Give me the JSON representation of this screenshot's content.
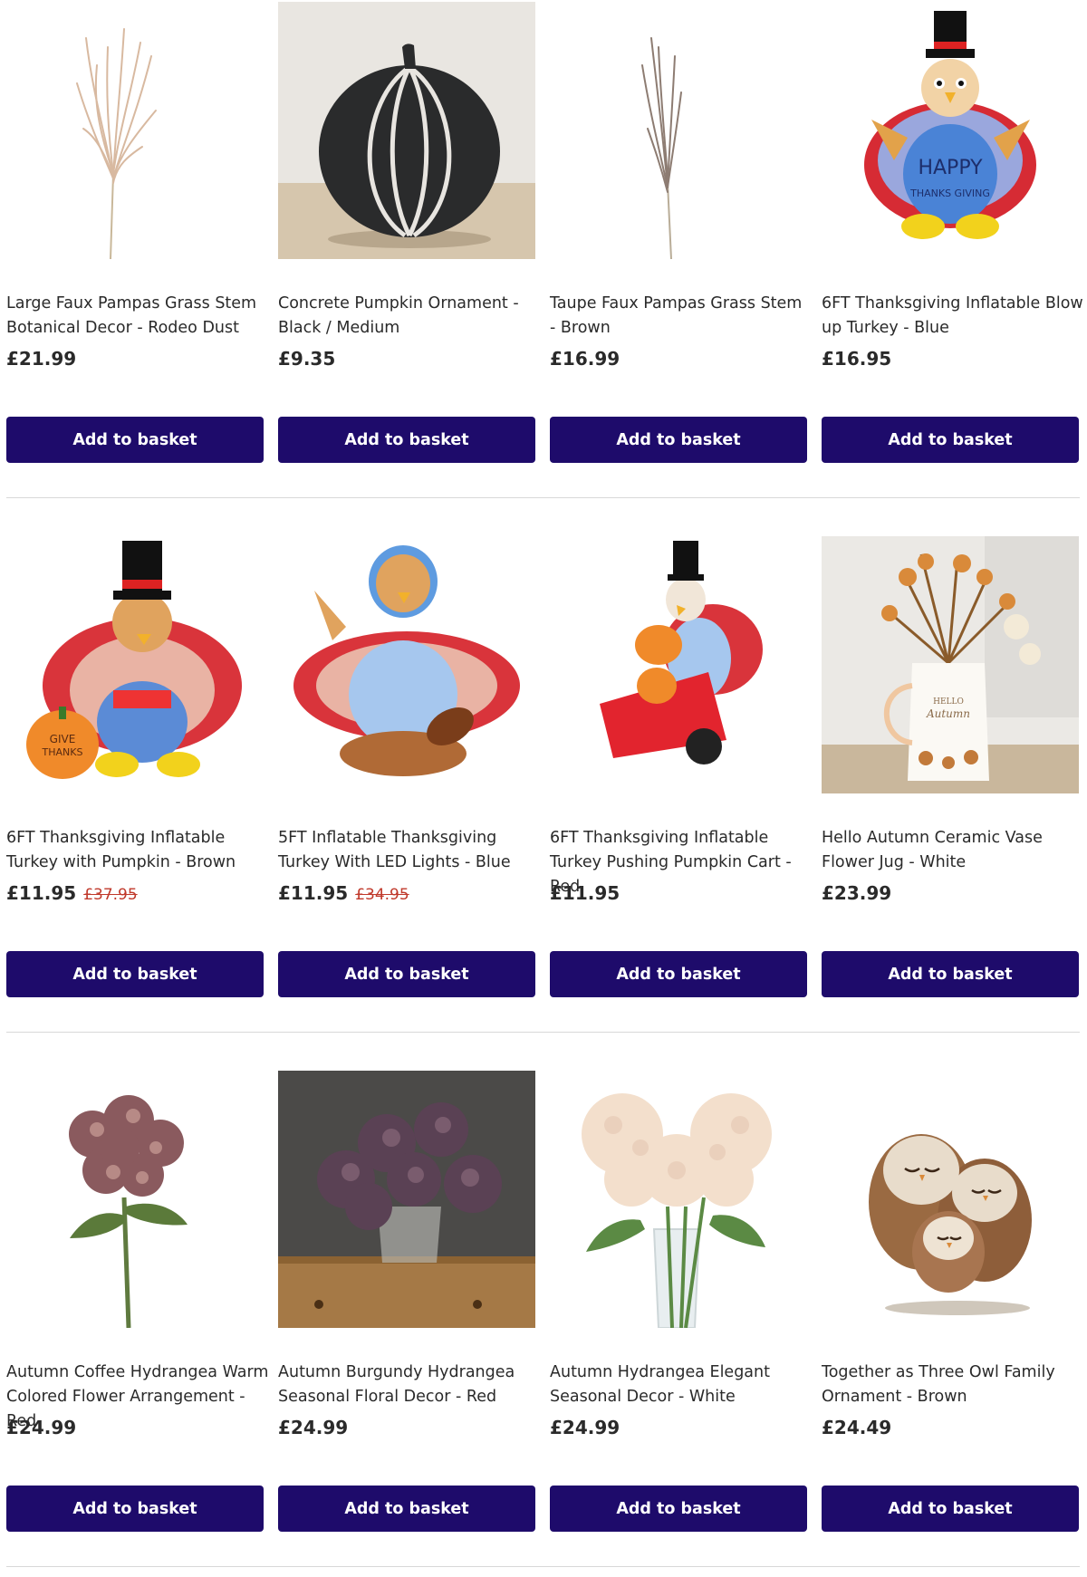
{
  "theme": {
    "button_bg": "#1e0b6b",
    "button_text": "#ffffff",
    "sale_price": "#c0392b",
    "divider": "#d8d8d8"
  },
  "products": [
    {
      "title": "Large Faux Pampas Grass Stem Botanical Decor - Rodeo Dust",
      "price": "£21.99",
      "old_price": "",
      "button": "Add to basket",
      "image": "pampas-grass-rodeo-dust"
    },
    {
      "title": "Concrete Pumpkin Ornament - Black / Medium",
      "price": "£9.35",
      "old_price": "",
      "button": "Add to basket",
      "image": "black-concrete-pumpkin"
    },
    {
      "title": "Taupe Faux Pampas Grass Stem - Brown",
      "price": "£16.99",
      "old_price": "",
      "button": "Add to basket",
      "image": "pampas-grass-taupe"
    },
    {
      "title": "6FT Thanksgiving Inflatable Blow up Turkey - Blue",
      "price": "£16.95",
      "old_price": "",
      "button": "Add to basket",
      "image": "inflatable-turkey-blue",
      "image_text_1": "HAPPY",
      "image_text_2": "THANKS GIVING"
    },
    {
      "title": "6FT Thanksgiving Inflatable Turkey with Pumpkin - Brown",
      "price": "£11.95",
      "old_price": "£37.95",
      "button": "Add to basket",
      "image": "inflatable-turkey-pumpkin",
      "image_text_1": "GIVE",
      "image_text_2": "THANKS"
    },
    {
      "title": "5FT Inflatable Thanksgiving Turkey With LED Lights - Blue",
      "price": "£11.95",
      "old_price": "£34.95",
      "button": "Add to basket",
      "image": "inflatable-turkey-football"
    },
    {
      "title": "6FT Thanksgiving Inflatable Turkey Pushing Pumpkin Cart - Red",
      "price": "£11.95",
      "old_price": "",
      "button": "Add to basket",
      "image": "inflatable-turkey-cart"
    },
    {
      "title": "Hello Autumn Ceramic Vase Flower Jug - White",
      "price": "£23.99",
      "old_price": "",
      "button": "Add to basket",
      "image": "hello-autumn-jug",
      "image_text_1": "HELLO",
      "image_text_2": "Autumn"
    },
    {
      "title": "Autumn Coffee Hydrangea Warm Colored Flower Arrangement - Red",
      "price": "£24.99",
      "old_price": "",
      "button": "Add to basket",
      "image": "coffee-hydrangea-stem"
    },
    {
      "title": "Autumn Burgundy Hydrangea Seasonal Floral Decor - Red",
      "price": "£24.99",
      "old_price": "",
      "button": "Add to basket",
      "image": "burgundy-hydrangea-vase"
    },
    {
      "title": "Autumn Hydrangea Elegant Seasonal Decor - White",
      "price": "£24.99",
      "old_price": "",
      "button": "Add to basket",
      "image": "white-hydrangea-vase"
    },
    {
      "title": "Together as Three Owl Family Ornament - Brown",
      "price": "£24.49",
      "old_price": "",
      "button": "Add to basket",
      "image": "owl-family-ornament"
    }
  ]
}
